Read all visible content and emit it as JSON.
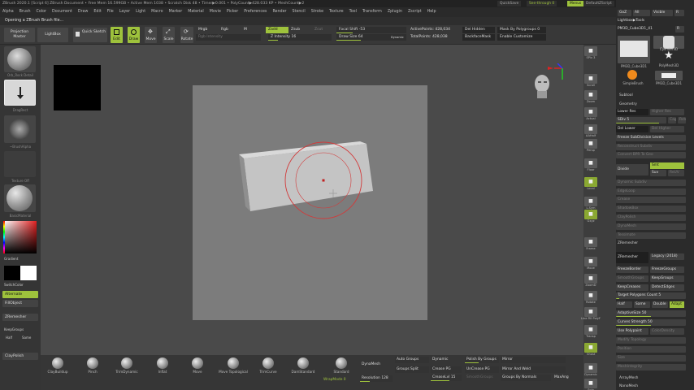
{
  "app": {
    "title": "ZBrush 2020.1 [Script 6]   ZBrush Document  • Free Mem 16.599GB • Active Mem 1038 • Scratch Disk 48 • Timer▶0.001 • PolyCount▶428.033 KP • MeshCount▶2",
    "quicksave": "QuickSave",
    "see_through": "See-through  0",
    "menus_label": "Menus",
    "default_script": "DefaultZScript"
  },
  "menubar": [
    "Alpha",
    "Brush",
    "Color",
    "Document",
    "Draw",
    "Edit",
    "File",
    "Layer",
    "Light",
    "Macro",
    "Marker",
    "Material",
    "Movie",
    "Picker",
    "Preferences",
    "Render",
    "Stencil",
    "Stroke",
    "Texture",
    "Tool",
    "Transform",
    "Zplugin",
    "Zscript",
    "Help"
  ],
  "notification": "Opening a ZBrush Brush file...",
  "shelf": {
    "projection_master": "Projection Master",
    "lightbox": "LightBox",
    "quick_sketch": "Quick Sketch",
    "edit": "Edit",
    "draw": "Draw",
    "move": "Move",
    "scale": "Scale",
    "rotate": "Rotate",
    "mrgb": "Mrgb",
    "rgb": "Rgb",
    "m": "M",
    "rgb_intensity": "Rgb Intensity",
    "zadd": "Zadd",
    "zsub": "Zsub",
    "zcut": "Zcut",
    "z_intensity": "Z Intensity 16",
    "focal_shift": "Focal Shift -53",
    "draw_size": "Draw Size 64",
    "dynamic": "Dynamic",
    "active_points": "ActivePoints: 428,034",
    "total_points": "TotalPoints: 428,038",
    "del_hidden": "Del Hidden",
    "backface_mask": "BackfaceMask",
    "mask_by_polygroups": "Mask By Polygroups 0",
    "enable_customize": "Enable Customize"
  },
  "lefttray": {
    "brush_label": "Orb_Rock Detail",
    "stroke_label": "DragRect",
    "alpha_label": "~BrushAlpha",
    "texture_label": "Texture Off",
    "material_label": "BasicMaterial",
    "gradient": "Gradient",
    "switch_color": "SwitchColor",
    "alternate": "Alternate",
    "fill_object": "FillObject",
    "zremesher": "ZRemesher",
    "keep_groups": "KeepGroups",
    "half": "Half",
    "same": "Same",
    "claypolish": "ClayPolish",
    "main_color": "#e02020"
  },
  "righttray": [
    {
      "label": "SPix 3",
      "icon": "spix-icon"
    },
    {
      "label": "Scroll",
      "icon": "scroll-icon"
    },
    {
      "label": "Zoom",
      "icon": "zoom-icon"
    },
    {
      "label": "Actual",
      "icon": "actual-icon"
    },
    {
      "label": "AAHalf",
      "icon": "aahalf-icon"
    },
    {
      "label": "Persp",
      "icon": "persp-icon"
    },
    {
      "label": "Floor",
      "icon": "floor-icon"
    },
    {
      "label": "Local",
      "icon": "local-icon"
    },
    {
      "label": "L.Sym",
      "icon": "lsym-icon"
    },
    {
      "label": "Gxyz",
      "icon": "gxyz-icon"
    },
    {
      "label": "Frame",
      "icon": "frame-icon"
    },
    {
      "label": "Move",
      "icon": "move-icon"
    },
    {
      "label": "ZoomD",
      "icon": "zoom3d-icon"
    },
    {
      "label": "Rotate",
      "icon": "rotate-icon"
    },
    {
      "label": "Line Fill PolyF",
      "icon": "polyf-icon"
    },
    {
      "label": "Transp",
      "icon": "transp-icon"
    },
    {
      "label": "Ghost",
      "icon": "ghost-icon"
    },
    {
      "label": "Dynamic",
      "icon": "dynamic-icon"
    },
    {
      "label": "Solo",
      "icon": "solo-icon"
    }
  ],
  "bottomshelf": {
    "brushes": [
      "ClayBuildup",
      "Pinch",
      "TrimDynamic",
      "Inflat",
      "Move",
      "Move Topological",
      "TrimCurve",
      "DamStandard",
      "Standard"
    ],
    "wrapmode": "WrapMode 0",
    "dynamesh": "DynaMesh",
    "resolution": "Resolution 128",
    "auto_groups": "Auto Groups",
    "groups_split": "Groups Split",
    "dynamic": "Dynamic",
    "crease_pg": "Crease PG",
    "crease_lvl": "CreaseLvl 15",
    "polish_by_groups": "Polish By Groups",
    "uncrease_pg": "UnCrease PG",
    "smooth_groups": "SmoothGroups",
    "mirror": "Mirror",
    "mirror_and_weld": "Mirror And Weld",
    "groups_by_normals": "Groups By Normals",
    "maxangle": "MaxAng"
  },
  "rightpanel": {
    "goz": "GoZ",
    "all": "All",
    "visible": "Visible",
    "r": "R",
    "lightbox_tools": "Lightbox▶Tools",
    "current_tool": "PM3D_Cube3D1_41",
    "r2": "R",
    "thumbs": [
      "PM3D_Cube3D1",
      "Cylinder3D",
      "SimpleBrush",
      "PolyMesh3D",
      "PM3D_Cube3D1"
    ],
    "subtool": "Subtool",
    "geometry": "Geometry",
    "lower_res": "Lower Res",
    "higher_res": "Higher Res",
    "sdiv": "SDiv 5",
    "cage": "Cage",
    "rstr": "Rstr",
    "del_lower": "Del Lower",
    "del_higher": "Del Higher",
    "freeze_subdiv": "Freeze SubDivision Levels",
    "reconstruct_subdiv": "Reconstruct Subdiv",
    "convert_bpr": "Convert BPR To Geo",
    "divide": "Divide",
    "smt": "Smt",
    "suv": "Suv",
    "reuv": "ReUV",
    "dynamic_subdiv": "Dynamic Subdiv",
    "edgeloop": "EdgeLoop",
    "crease": "Crease",
    "shadowbox": "ShadowBox",
    "claypolish": "ClayPolish",
    "dynamesh": "DynaMesh",
    "tessimate": "Tessimate",
    "zremesher_head": "ZRemesher",
    "zremesher": "ZRemesher",
    "legacy": "Legacy (2018)",
    "freeze_border": "FreezeBorder",
    "freeze_groups": "FreezeGroups",
    "smooth_groups": "SmoothGroups",
    "keep_groups": "KeepGroups",
    "keep_creases": "KeepCreases",
    "detect_edges": "DetectEdges",
    "target_polygons": "Target Polygons Count 5",
    "half": "Half",
    "same": "Same",
    "double": "Double",
    "adapt": "Adapt",
    "adaptive_size": "AdaptiveSize 50",
    "curves_strength": "Curves Strength 50",
    "use_polypaint": "Use Polypaint",
    "color_density": "ColorDensity",
    "modify_topology": "Modify Topology",
    "position": "Position",
    "size": "Size",
    "meshintegrity": "MeshIntegrity",
    "arraymesh": "ArrayMesh",
    "nanomesh": "NanoMesh"
  },
  "colors": {
    "accent": "#9ec23c",
    "brush_circle": "#d23a3a"
  }
}
